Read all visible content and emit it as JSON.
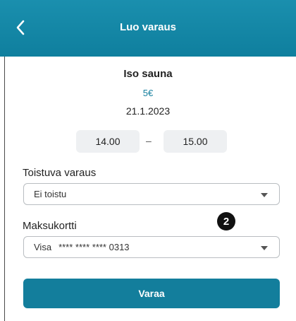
{
  "header": {
    "title": "Luo varaus",
    "back_icon": "chevron-left-icon"
  },
  "booking": {
    "name": "Iso sauna",
    "price": "5€",
    "date": "21.1.2023",
    "start_time": "14.00",
    "separator": "–",
    "end_time": "15.00"
  },
  "recurring": {
    "label": "Toistuva varaus",
    "value": "Ei toistu"
  },
  "payment": {
    "label": "Maksukortti",
    "card_brand": "Visa",
    "card_number": "**** **** **** 0313"
  },
  "annotation": {
    "badge": "2"
  },
  "actions": {
    "submit_label": "Varaa"
  },
  "colors": {
    "primary": "#137e9c",
    "price": "#157f9e"
  }
}
